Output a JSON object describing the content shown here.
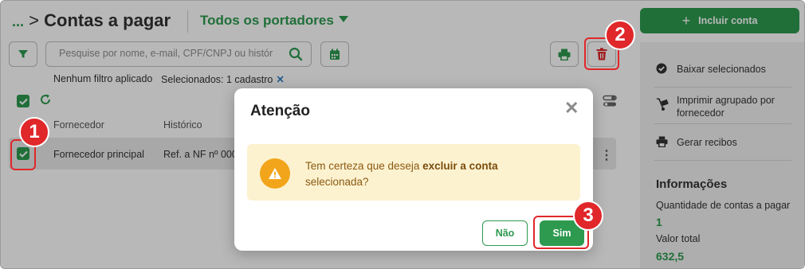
{
  "header": {
    "breadcrumb_prefix": "...",
    "title": "Contas a pagar",
    "portador_filter": "Todos os portadores"
  },
  "toolbar": {
    "search_placeholder": "Pesquise por nome, e-mail, CPF/CNPJ ou histór",
    "filter_status": "Nenhum filtro aplicado",
    "selection_status": "Selecionados: 1 cadastro",
    "selection_clear": "✕"
  },
  "table": {
    "columns": [
      "Fornecedor",
      "Histórico"
    ],
    "rows": [
      {
        "fornecedor": "Fornecedor principal",
        "historico": "Ref. a NF nº 000",
        "selected": true
      }
    ]
  },
  "sidebar": {
    "primary_action": "Incluir conta",
    "actions": [
      {
        "label": "Baixar selecionados",
        "icon": "check-circle-icon"
      },
      {
        "label": "Imprimir agrupado por fornecedor",
        "icon": "hand-cart-icon"
      },
      {
        "label": "Gerar recibos",
        "icon": "printer-icon"
      }
    ],
    "info_title": "Informações",
    "info": [
      {
        "label": "Quantidade de contas a pagar",
        "value": "1"
      },
      {
        "label": "Valor total",
        "value": "632,5"
      }
    ]
  },
  "modal": {
    "title": "Atenção",
    "close": "✕",
    "message_prefix": "Tem certeza que deseja ",
    "message_bold": "excluir a conta",
    "message_suffix": " selecionada?",
    "cancel_label": "Não",
    "confirm_label": "Sim"
  },
  "annotations": [
    "1",
    "2",
    "3"
  ],
  "colors": {
    "brand_green": "#2d9a4f",
    "annotation_red": "#e0272a",
    "warning_orange": "#f2a51a",
    "alert_bg": "#fdf2d0"
  }
}
